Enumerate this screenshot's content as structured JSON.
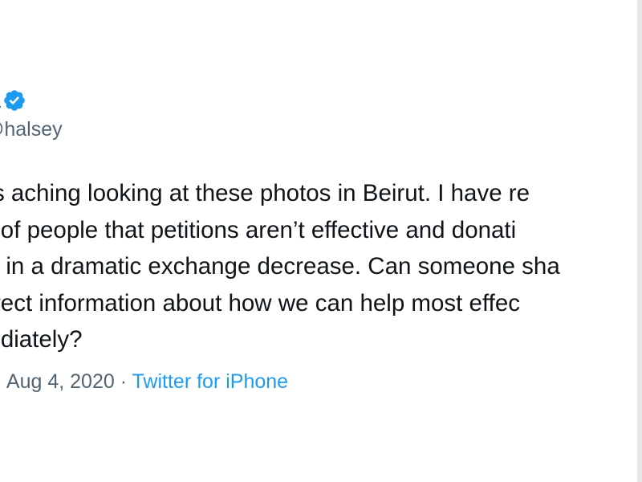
{
  "author": {
    "display_name": "a",
    "handle": "@halsey",
    "verified_icon": "verified-badge-icon"
  },
  "tweet": {
    "lines": [
      "t is aching looking at these photos in Beirut. I have re",
      "ot of people that petitions aren’t effective and donati",
      "ult in a dramatic exchange decrease. Can someone sha",
      " direct information about how we can help most effec",
      "nediately?"
    ]
  },
  "meta": {
    "prefix": "·",
    "date": "Aug 4, 2020",
    "separator": "·",
    "source": "Twitter for iPhone"
  },
  "colors": {
    "text": "#0f1419",
    "secondary": "#536471",
    "link": "#1d9bf0"
  }
}
